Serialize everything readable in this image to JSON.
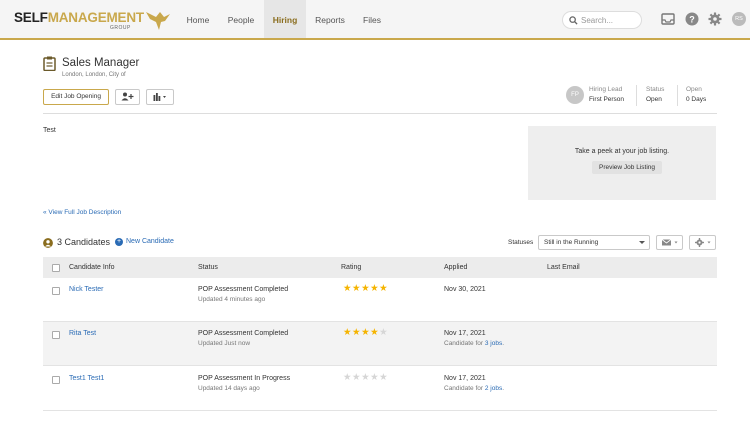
{
  "brand": {
    "logo_main_a": "SELF",
    "logo_main_b": "MANAGEMENT",
    "logo_sub": "GROUP"
  },
  "nav": {
    "items": [
      {
        "label": "Home",
        "active": false
      },
      {
        "label": "People",
        "active": false
      },
      {
        "label": "Hiring",
        "active": true
      },
      {
        "label": "Reports",
        "active": false
      },
      {
        "label": "Files",
        "active": false
      }
    ],
    "search_placeholder": "Search...",
    "user_initials": "RS"
  },
  "job": {
    "title": "Sales Manager",
    "location": "London, London, City of",
    "edit_label": "Edit Job Opening",
    "hiring_lead_initials": "FP",
    "hiring_lead_label": "Hiring Lead",
    "hiring_lead_value": "First Person",
    "status_label": "Status",
    "status_value": "Open",
    "open_label": "Open",
    "open_value": "0 Days",
    "description": "Test",
    "full_description_link": "View Full Job Description"
  },
  "preview": {
    "text": "Take a peek at your job listing.",
    "button": "Preview Job Listing"
  },
  "candidates": {
    "count_label": "3 Candidates",
    "new_label": "New Candidate",
    "statuses_label": "Statuses",
    "statuses_selected": "Still in the Running",
    "columns": [
      "Candidate Info",
      "Status",
      "Rating",
      "Applied",
      "Last Email"
    ],
    "rows": [
      {
        "name": "Nick Tester",
        "status": "POP Assessment Completed",
        "updated": "Updated 4 minutes ago",
        "rating": 5,
        "applied": "Nov 30, 2021",
        "candidate_for_prefix": "",
        "candidate_for_link": "",
        "candidate_for_suffix": ""
      },
      {
        "name": "Rita Test",
        "status": "POP Assessment Completed",
        "updated": "Updated Just now",
        "rating": 4,
        "applied": "Nov 17, 2021",
        "candidate_for_prefix": "Candidate for ",
        "candidate_for_link": "3 jobs",
        "candidate_for_suffix": "."
      },
      {
        "name": "Test1 Test1",
        "status": "POP Assessment In Progress",
        "updated": "Updated 14 days ago",
        "rating": 0,
        "applied": "Nov 17, 2021",
        "candidate_for_prefix": "Candidate for ",
        "candidate_for_link": "2 jobs",
        "candidate_for_suffix": "."
      }
    ]
  },
  "colors": {
    "accent": "#c9a84c",
    "link": "#2a6bb5",
    "star": "#f5b400"
  }
}
